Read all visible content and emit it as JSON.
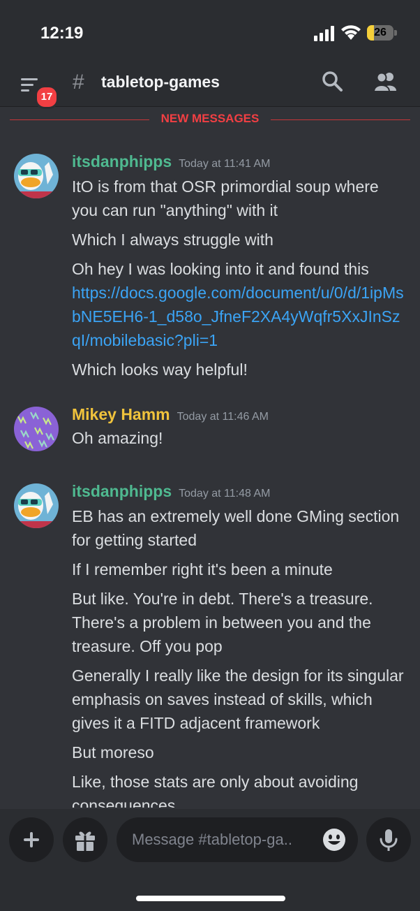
{
  "status_bar": {
    "time": "12:19",
    "battery": "26",
    "battery_level": 0.26
  },
  "header": {
    "badge_count": "17",
    "channel_name": "tabletop-games",
    "hash": "#"
  },
  "divider": {
    "label": "NEW MESSAGES"
  },
  "messages": [
    {
      "author": "itsdanphipps",
      "author_color": "#4fb990",
      "timestamp": "Today at 11:41 AM",
      "avatar": "duck-avatar",
      "lines": [
        {
          "text": "ItO is from that OSR primordial soup where you can run \"anything\" with it"
        },
        {
          "text": "Which I always struggle with"
        },
        {
          "text": "Oh hey I was looking into it and found this",
          "link": "https://docs.google.com/document/u/0/d/1ipMsbNE5EH6-1_d58o_JfneF2XA4yWqfr5XxJInSzqI/mobilebasic?pli=1"
        },
        {
          "text": "Which looks way helpful!"
        }
      ]
    },
    {
      "author": "Mikey Hamm",
      "author_color": "#f0c33c",
      "timestamp": "Today at 11:46 AM",
      "avatar": "purple-pattern-avatar",
      "lines": [
        {
          "text": "Oh amazing!"
        }
      ]
    },
    {
      "author": "itsdanphipps",
      "author_color": "#4fb990",
      "timestamp": "Today at 11:48 AM",
      "avatar": "duck-avatar",
      "lines": [
        {
          "text": "EB has an extremely well done GMing section for getting started"
        },
        {
          "text": "If I remember right it's been a minute"
        },
        {
          "text": "But like. You're in debt. There's a treasure. There's a problem in between you and the treasure. Off you pop"
        },
        {
          "text": "Generally I really like the design for its singular emphasis on saves instead of skills, which gives it a FITD adjacent framework"
        },
        {
          "text": "But moreso"
        },
        {
          "text": "Like, those stats are only about avoiding consequences"
        }
      ]
    }
  ],
  "composer": {
    "placeholder": "Message #tabletop-ga.."
  },
  "icons": [
    "menu-icon",
    "search-icon",
    "members-icon",
    "plus-icon",
    "gift-icon",
    "emoji-icon",
    "microphone-icon",
    "signal-icon",
    "wifi-icon",
    "battery-icon"
  ]
}
